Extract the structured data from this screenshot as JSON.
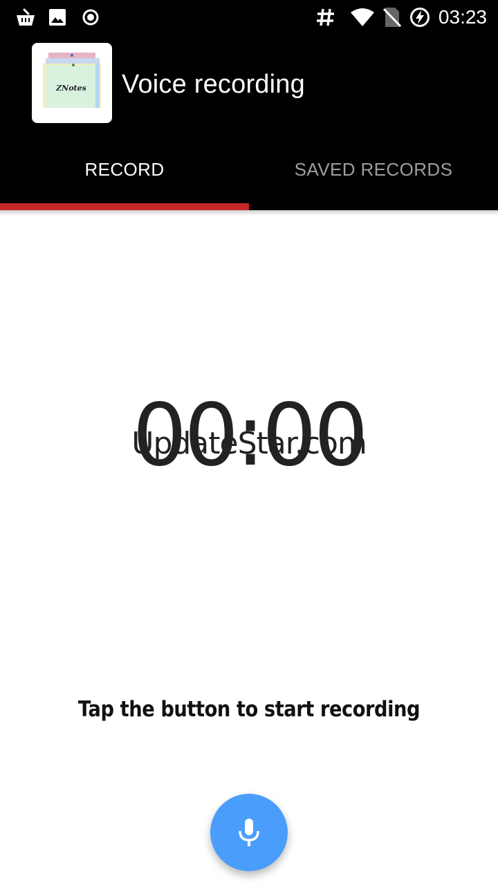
{
  "status_bar": {
    "time": "03:23",
    "icons": [
      "shopping-basket-icon",
      "image-icon",
      "record-circle-icon",
      "hash-icon",
      "wifi-icon",
      "no-sim-icon",
      "battery-charging-icon"
    ]
  },
  "app_bar": {
    "logo_text": "ZNotes",
    "title": "Voice recording"
  },
  "tabs": [
    {
      "label": "RECORD",
      "selected": true
    },
    {
      "label": "SAVED RECORDS",
      "selected": false
    }
  ],
  "colors": {
    "tab_indicator": "#c62828",
    "fab": "#4b9dfb"
  },
  "recorder": {
    "timer": "00:00",
    "watermark": "UpdateStar.com",
    "hint": "Tap the button to start recording",
    "fab_icon": "microphone-icon"
  }
}
